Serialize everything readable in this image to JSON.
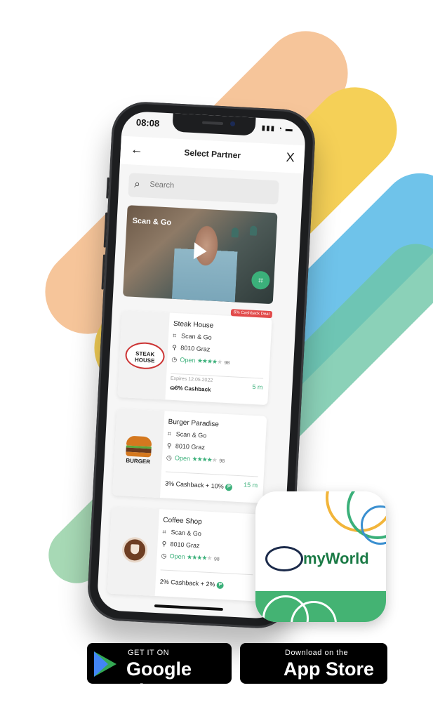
{
  "status": {
    "time": "08:08",
    "icons": "▮▮▮ ◔ ▬"
  },
  "header": {
    "title": "Select Partner",
    "back": "←",
    "close": "X"
  },
  "search": {
    "placeholder": "Search"
  },
  "video": {
    "label": "Scan & Go"
  },
  "partners": [
    {
      "name": "Steak House",
      "type": "Scan & Go",
      "location": "8010 Graz",
      "status": "Open",
      "stars": "★★★★",
      "star_empty": "★",
      "rating_count": "98",
      "badge": "6% Cashback Deal",
      "expires": "Expires 12.05.2022",
      "cashback": "6% Cashback",
      "distance": "5 m",
      "logo_text": "STEAK HOUSE"
    },
    {
      "name": "Burger Paradise",
      "type": "Scan & Go",
      "location": "8010 Graz",
      "status": "Open",
      "stars": "★★★★",
      "star_empty": "★",
      "rating_count": "98",
      "cashback": "3% Cashback + 10%",
      "distance": "15 m",
      "logo_text": "BURGER"
    },
    {
      "name": "Coffee Shop",
      "type": "Scan & Go",
      "location": "8010 Graz",
      "status": "Open",
      "stars": "★★★★",
      "star_empty": "★",
      "rating_count": "98",
      "cashback": "2% Cashback + 2%"
    }
  ],
  "app_icon": {
    "brand": "myWorld"
  },
  "stores": {
    "google": {
      "small": "GET IT ON",
      "big": "Google Play"
    },
    "apple": {
      "small": "Download on the",
      "big": "App Store"
    }
  },
  "colors": {
    "accent_green": "#3bb07a",
    "deal_red": "#e24b4b",
    "brand_green": "#44b373"
  }
}
